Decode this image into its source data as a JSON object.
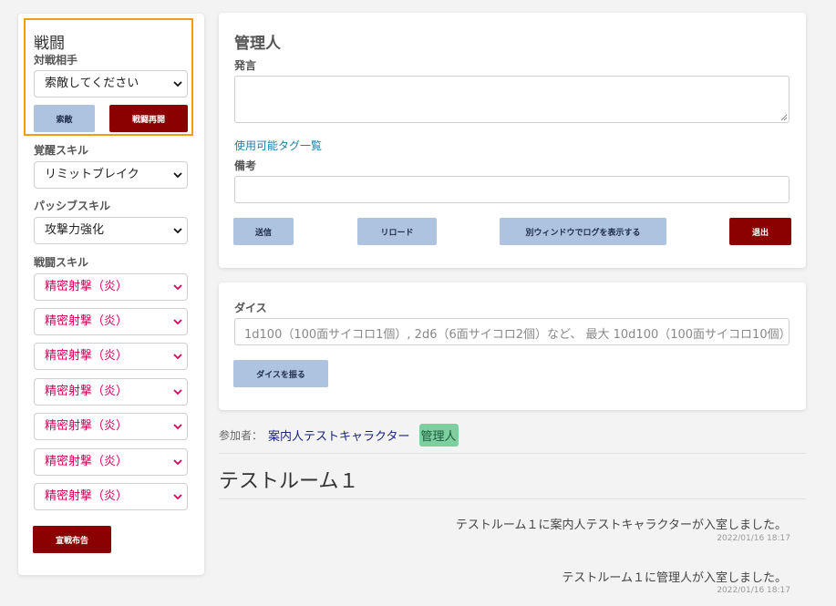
{
  "left": {
    "title": "戦闘",
    "opponent_label": "対戦相手",
    "opponent_value": "索敵してください",
    "search_button": "索敵",
    "resume_button": "戦闘再開",
    "awakening_label": "覚醒スキル",
    "awakening_value": "リミットブレイク",
    "passive_label": "パッシブスキル",
    "passive_value": "攻撃力強化",
    "battle_skill_label": "戦闘スキル",
    "battle_skills": [
      "精密射撃（炎）",
      "精密射撃（炎）",
      "精密射撃（炎）",
      "精密射撃（炎）",
      "精密射撃（炎）",
      "精密射撃（炎）",
      "精密射撃（炎）"
    ],
    "declare_button": "宣戦布告",
    "highlight_color": "#f39c12"
  },
  "post": {
    "title": "管理人",
    "speech_label": "発言",
    "tags_link": "使用可能タグ一覧",
    "note_label": "備考",
    "send_button": "送信",
    "reload_button": "リロード",
    "log_button": "別ウィンドウでログを表示する",
    "exit_button": "退出"
  },
  "dice": {
    "label": "ダイス",
    "placeholder": "1d100（100面サイコロ1個）, 2d6（6面サイコロ2個）など、 最大 10d100（100面サイコロ10個）",
    "roll_button": "ダイスを振る"
  },
  "participants": {
    "label": "参加者：",
    "names": [
      "案内人テストキャラクター",
      "管理人"
    ]
  },
  "room": {
    "title": "テストルーム１",
    "messages": [
      {
        "text": "テストルーム１に案内人テストキャラクターが入室しました。",
        "time": "2022/01/16 18:17"
      },
      {
        "text": "テストルーム１に管理人が入室しました。",
        "time": "2022/01/16 18:17"
      }
    ]
  }
}
